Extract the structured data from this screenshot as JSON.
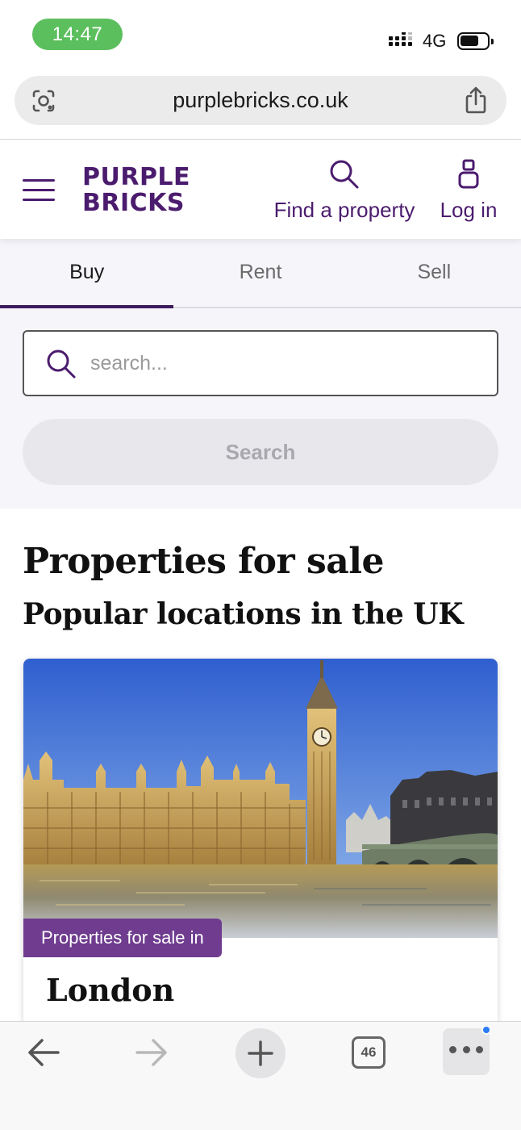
{
  "status_bar": {
    "time": "14:47",
    "network": "4G"
  },
  "browser": {
    "url": "purplebricks.co.uk",
    "tab_count": "46"
  },
  "header": {
    "logo_line1": "PURPLE",
    "logo_line2": "BRICKS",
    "find_property": "Find a property",
    "log_in": "Log in"
  },
  "tabs": [
    "Buy",
    "Rent",
    "Sell"
  ],
  "active_tab": "Buy",
  "search": {
    "placeholder": "search...",
    "button_label": "Search"
  },
  "main": {
    "title": "Properties for sale",
    "subtitle": "Popular locations in the UK"
  },
  "card": {
    "badge": "Properties for sale in",
    "title": "London"
  },
  "colors": {
    "brand_purple": "#4b1c6e",
    "badge_purple": "#6f3c8f",
    "status_green": "#5cbf5e",
    "notification_blue": "#2b7bf5"
  }
}
